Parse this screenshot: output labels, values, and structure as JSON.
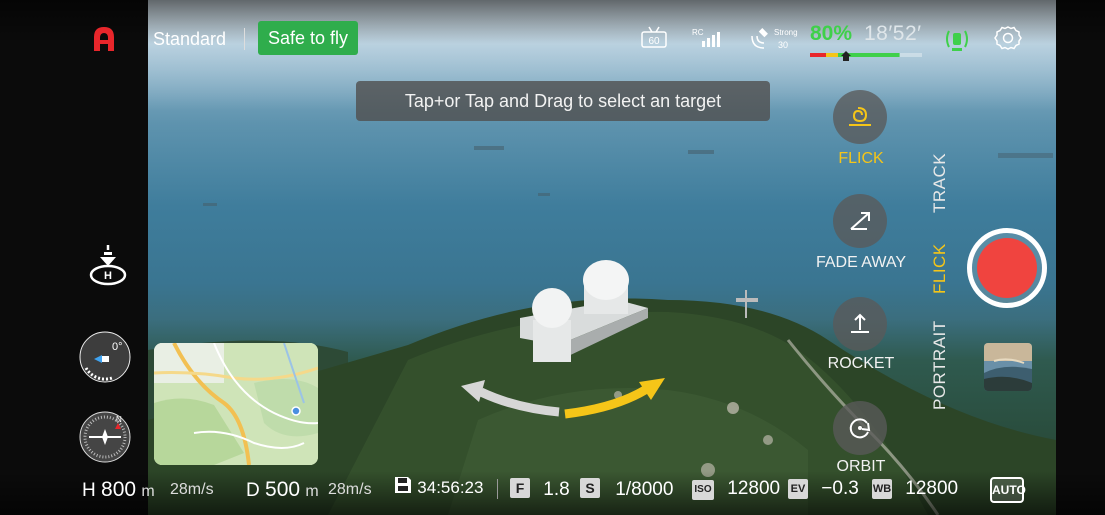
{
  "top_bar": {
    "mode": "Standard",
    "flight_status": "Safe to fly",
    "fps_label": "60",
    "rc_label": "RC",
    "gps_strength": "Strong",
    "gps_satellites": "30",
    "battery_percent": "80%",
    "flight_time": "18′52′",
    "battery_level": 0.8
  },
  "toast": {
    "message": "Tap+or Tap and Drag to select an target"
  },
  "attitude": {
    "pitch_label": "0°"
  },
  "compass": {
    "north_label": "N"
  },
  "modes": {
    "flick": "FLICK",
    "fade_away": "FADE AWAY",
    "rocket": "ROCKET",
    "orbit": "ORBIT"
  },
  "mode_tabs": {
    "track": "TRACK",
    "flick": "FLICK",
    "portrait": "PORTRAIT"
  },
  "telemetry": {
    "height_prefix": "H",
    "height_value": "800",
    "height_unit": "m",
    "vertical_speed": "28m/s",
    "distance_prefix": "D",
    "distance_value": "500",
    "distance_unit": "m",
    "horizontal_speed": "28m/s",
    "storage_time": "34:56:23"
  },
  "camera": {
    "aperture_badge": "F",
    "aperture": "1.8",
    "shutter_badge": "S",
    "shutter": "1/8000",
    "iso_badge": "ISO",
    "iso": "12800",
    "ev_badge": "EV",
    "ev": "−0.3",
    "wb_badge": "WB",
    "wb": "12800",
    "auto_label": "AUTO"
  },
  "colors": {
    "safe_green": "#2fad4c",
    "battery_green": "#3fd04a",
    "active_yellow": "#f5c518",
    "record_red": "#f0443f"
  }
}
